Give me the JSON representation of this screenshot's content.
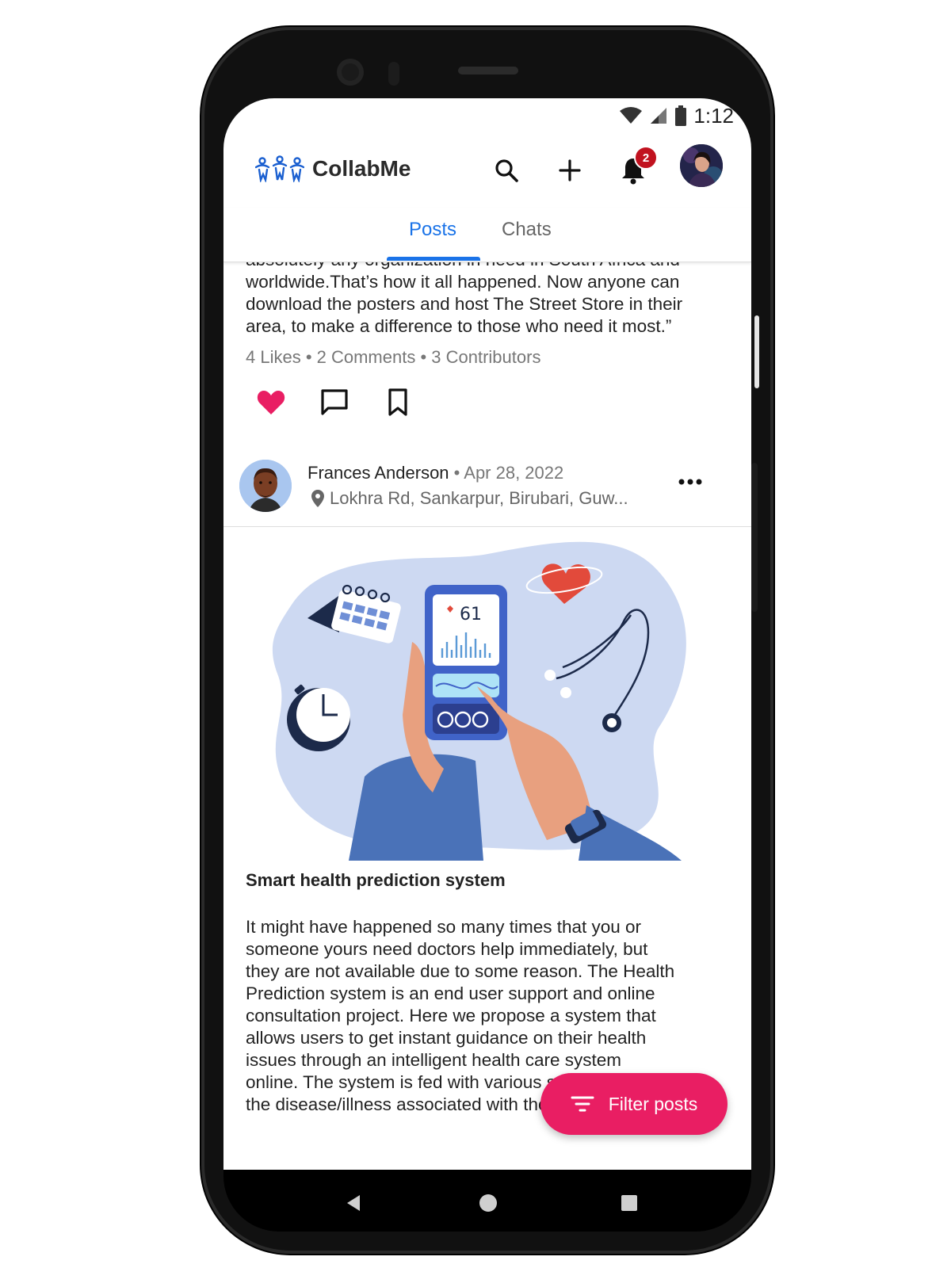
{
  "status_bar": {
    "time": "1:12"
  },
  "app": {
    "name": "CollabMe",
    "notification_count": "2"
  },
  "tabs": [
    {
      "label": "Posts",
      "active": true
    },
    {
      "label": "Chats",
      "active": false
    }
  ],
  "prev_post": {
    "text_lines": [
      "absolutely any organization in need in South Africa and",
      "worldwide.That’s how it all happened. Now anyone can",
      "download the posters and host The Street Store in their",
      "area, to make a difference to those who need it most.”"
    ],
    "stats": "4 Likes • 2 Comments • 3 Contributors",
    "liked": true
  },
  "post": {
    "author": "Frances Anderson",
    "separator": " • ",
    "date": "Apr 28, 2022",
    "location": "Lokhra Rd, Sankarpur, Birubari, Guw...",
    "image_reading": "61",
    "title": "Smart health prediction system",
    "body_lines": [
      "It might have happened so many times that you or",
      "someone yours need doctors help immediately, but",
      "they are not available due to some reason. The Health",
      "Prediction system is an end user support and online",
      "consultation project. Here we propose a system that",
      "allows users to get instant guidance on their health",
      "issues through an intelligent health care system",
      "online. The system is fed with various symptoms and",
      "the disease/illness associated with those systems."
    ]
  },
  "fab": {
    "label": "Filter posts"
  },
  "colors": {
    "accent": "#1a73e8",
    "like": "#e91e63",
    "fab": "#e91e63",
    "badge": "#c1121f"
  },
  "icons": [
    "wifi-icon",
    "signal-icon",
    "battery-icon",
    "search-icon",
    "plus-icon",
    "bell-icon",
    "heart-icon",
    "comment-icon",
    "bookmark-icon",
    "location-pin-icon",
    "more-icon",
    "filter-icon",
    "back-icon",
    "home-icon",
    "recents-icon"
  ]
}
